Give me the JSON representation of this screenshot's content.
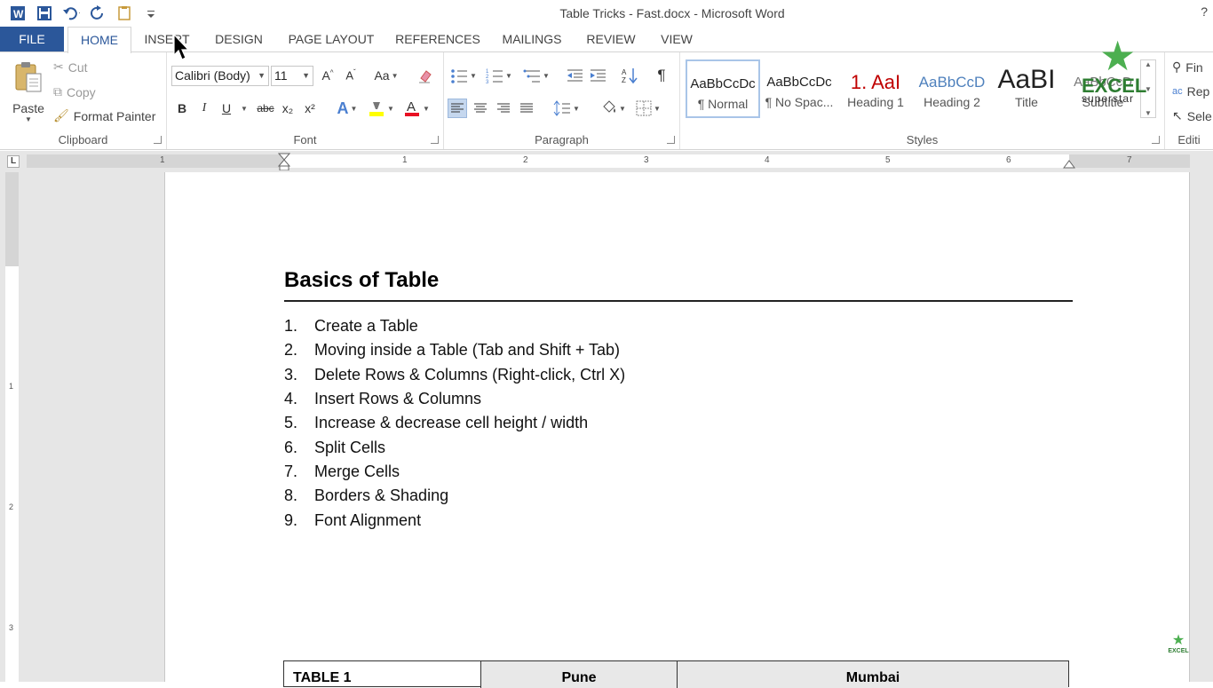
{
  "window": {
    "title": "Table Tricks - Fast.docx - Microsoft Word",
    "help": "?"
  },
  "quick_access": [
    "word-logo-icon",
    "save-icon",
    "undo-icon",
    "redo-icon",
    "touch-mode-icon",
    "customize-icon"
  ],
  "tabs": [
    "FILE",
    "HOME",
    "INSERT",
    "DESIGN",
    "PAGE LAYOUT",
    "REFERENCES",
    "MAILINGS",
    "REVIEW",
    "VIEW"
  ],
  "active_tab": "HOME",
  "clipboard": {
    "paste": "Paste",
    "cut": "Cut",
    "copy": "Copy",
    "format_painter": "Format Painter",
    "label": "Clipboard"
  },
  "font": {
    "name": "Calibri (Body)",
    "size": "11",
    "change_case": "Aa",
    "bold": "B",
    "italic": "I",
    "underline": "U",
    "strikethrough": "abc",
    "subscript": "x₂",
    "superscript": "x²",
    "label": "Font"
  },
  "paragraph": {
    "label": "Paragraph",
    "pilcrow": "¶"
  },
  "styles": {
    "label": "Styles",
    "items": [
      {
        "sample": "AaBbCcDc",
        "name": "¶ Normal"
      },
      {
        "sample": "AaBbCcDc",
        "name": "¶ No Spac..."
      },
      {
        "sample": "1. AaI",
        "name": "Heading 1"
      },
      {
        "sample": "AaBbCcD",
        "name": "Heading 2"
      },
      {
        "sample": "AaBI",
        "name": "Title"
      },
      {
        "sample": "AaBbCcD",
        "name": "Subtitle"
      }
    ]
  },
  "editing": {
    "find": "Fin",
    "replace": "Rep",
    "select": "Sele",
    "label": "Editi"
  },
  "ruler": {
    "numbers": [
      "1",
      "1",
      "2",
      "3",
      "4",
      "5",
      "6",
      "7"
    ],
    "tab_selector": "L"
  },
  "vertical_ruler": [
    "1",
    "2",
    "3"
  ],
  "document": {
    "heading": "Basics of Table",
    "list": [
      "Create a Table",
      "Moving inside a Table (Tab and Shift + Tab)",
      "Delete Rows & Columns (Right-click, Ctrl X)",
      "Insert Rows & Columns",
      "Increase & decrease cell height / width",
      "Split Cells",
      "Merge Cells",
      "Borders & Shading",
      "Font Alignment"
    ],
    "table_header": [
      "TABLE 1",
      "Pune",
      "Mumbai"
    ]
  },
  "watermark": {
    "brand": "EXCEL",
    "tagline": "superstar"
  },
  "colors": {
    "file_tab": "#2b579a",
    "highlight": "#ffff00",
    "font_color": "#e81123",
    "star_green": "#4caf50"
  }
}
